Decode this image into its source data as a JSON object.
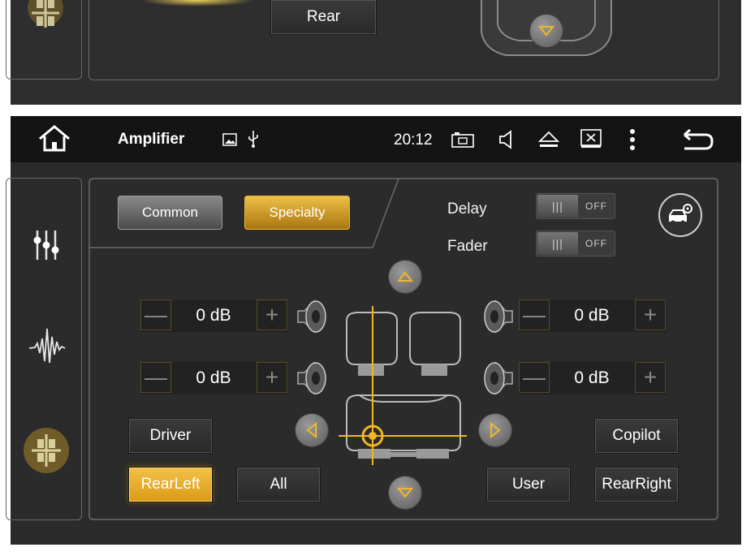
{
  "top_panel": {
    "rear_button_label": "Rear"
  },
  "status_bar": {
    "title": "Amplifier",
    "time": "20:12"
  },
  "mode_tabs": {
    "common_label": "Common",
    "specialty_label": "Specialty"
  },
  "settings": {
    "delay_label": "Delay",
    "delay_state": "OFF",
    "fader_label": "Fader",
    "fader_state": "OFF"
  },
  "levels": {
    "front_left": "0 dB",
    "front_right": "0 dB",
    "rear_left": "0 dB",
    "rear_right": "0 dB"
  },
  "positions": {
    "driver_label": "Driver",
    "copilot_label": "Copilot",
    "rear_left_label": "RearLeft",
    "all_label": "All",
    "user_label": "User",
    "rear_right_label": "RearRight",
    "selected": "RearLeft"
  },
  "icons": {
    "home": "home-icon",
    "gallery": "image-icon",
    "usb": "usb-icon",
    "screenshot": "camera-icon",
    "volume": "volume-icon",
    "eject": "eject-icon",
    "close_window": "close-window-icon",
    "menu": "menu-icon",
    "back": "back-icon",
    "equalizer": "equalizer-icon",
    "waveform": "waveform-icon",
    "balance": "balance-icon",
    "car_settings": "car-settings-icon"
  },
  "colors": {
    "accent": "#f2b824",
    "panel_bg": "#2e2e2e",
    "status_bar_bg": "#111111"
  }
}
